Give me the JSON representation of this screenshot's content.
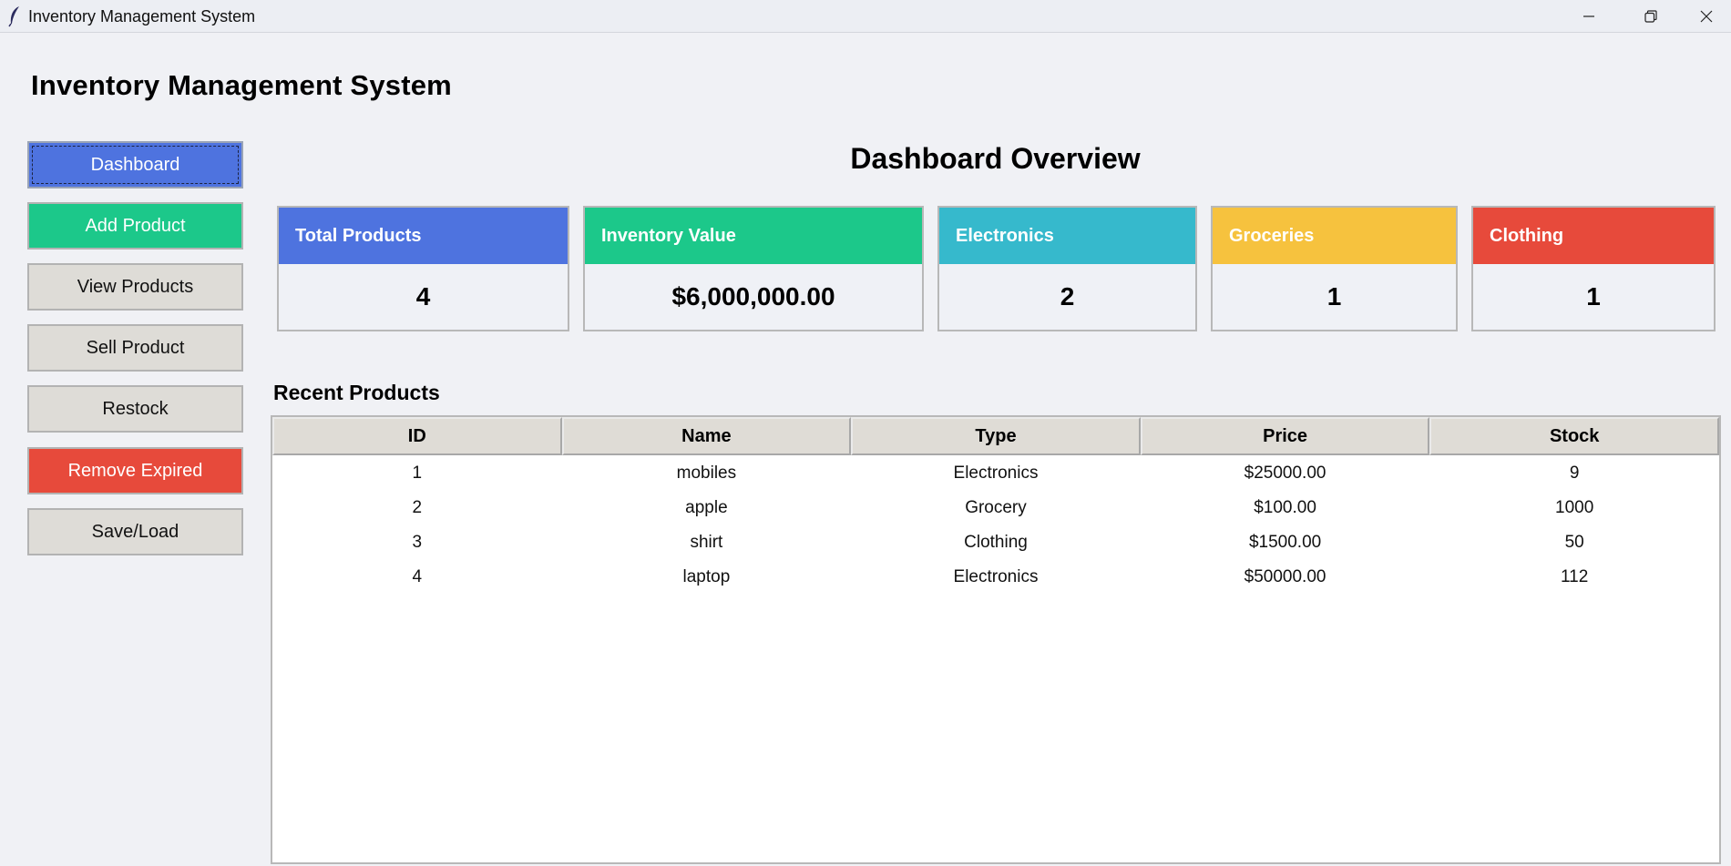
{
  "window": {
    "title": "Inventory Management System"
  },
  "app": {
    "heading": "Inventory Management System"
  },
  "nav": {
    "dashboard": "Dashboard",
    "add_product": "Add Product",
    "view_products": "View Products",
    "sell_product": "Sell Product",
    "restock": "Restock",
    "remove_expired": "Remove Expired",
    "save_load": "Save/Load"
  },
  "dashboard": {
    "title": "Dashboard Overview",
    "cards": [
      {
        "label": "Total Products",
        "value": "4",
        "color": "#4e73df"
      },
      {
        "label": "Inventory Value",
        "value": "$6,000,000.00",
        "color": "#1cc88a"
      },
      {
        "label": "Electronics",
        "value": "2",
        "color": "#36b9cc"
      },
      {
        "label": "Groceries",
        "value": "1",
        "color": "#f6c23e"
      },
      {
        "label": "Clothing",
        "value": "1",
        "color": "#e74a3b"
      }
    ]
  },
  "recent": {
    "title": "Recent Products",
    "columns": [
      "ID",
      "Name",
      "Type",
      "Price",
      "Stock"
    ],
    "rows": [
      [
        "1",
        "mobiles",
        "Electronics",
        "$25000.00",
        "9"
      ],
      [
        "2",
        "apple",
        "Grocery",
        "$100.00",
        "1000"
      ],
      [
        "3",
        "shirt",
        "Clothing",
        "$1500.00",
        "50"
      ],
      [
        "4",
        "laptop",
        "Electronics",
        "$50000.00",
        "112"
      ]
    ]
  },
  "icons": {
    "app": "feather-icon",
    "minimize": "minimize-icon",
    "maximize": "restore-icon",
    "close": "close-icon"
  }
}
